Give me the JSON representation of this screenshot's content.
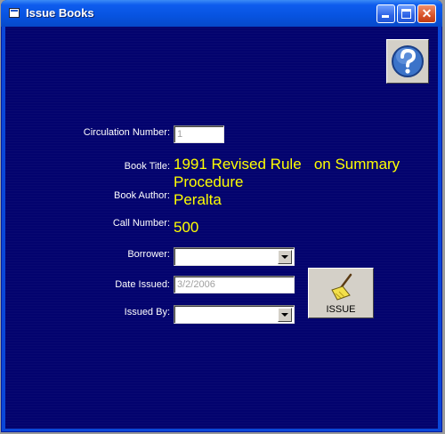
{
  "window": {
    "title": "Issue Books",
    "icon": "document-icon",
    "controls": {
      "minimize": "minimize-icon",
      "maximize": "maximize-icon",
      "close": "close-icon",
      "close_glyph": "✕"
    }
  },
  "help": {
    "icon": "question-mark-icon"
  },
  "form": {
    "circulation_number": {
      "label": "Circulation Number:",
      "value": "1"
    },
    "book_title": {
      "label": "Book Title:",
      "value_line1": "1991 Revised Rule   on Summary",
      "value_line2": "Procedure"
    },
    "book_author": {
      "label": "Book Author:",
      "value": "Peralta"
    },
    "call_number": {
      "label": "Call Number:",
      "value": "500"
    },
    "borrower": {
      "label": "Borrower:",
      "value": ""
    },
    "date_issued": {
      "label": "Date Issued:",
      "value": "3/2/2006"
    },
    "issued_by": {
      "label": "Issued By:",
      "value": ""
    }
  },
  "issue_button": {
    "label": "ISSUE",
    "icon": "broom-icon"
  },
  "colors": {
    "background": "#03036e",
    "value_text": "#ffff00",
    "label_text": "#ffffff",
    "titlebar": "#0753e0"
  }
}
